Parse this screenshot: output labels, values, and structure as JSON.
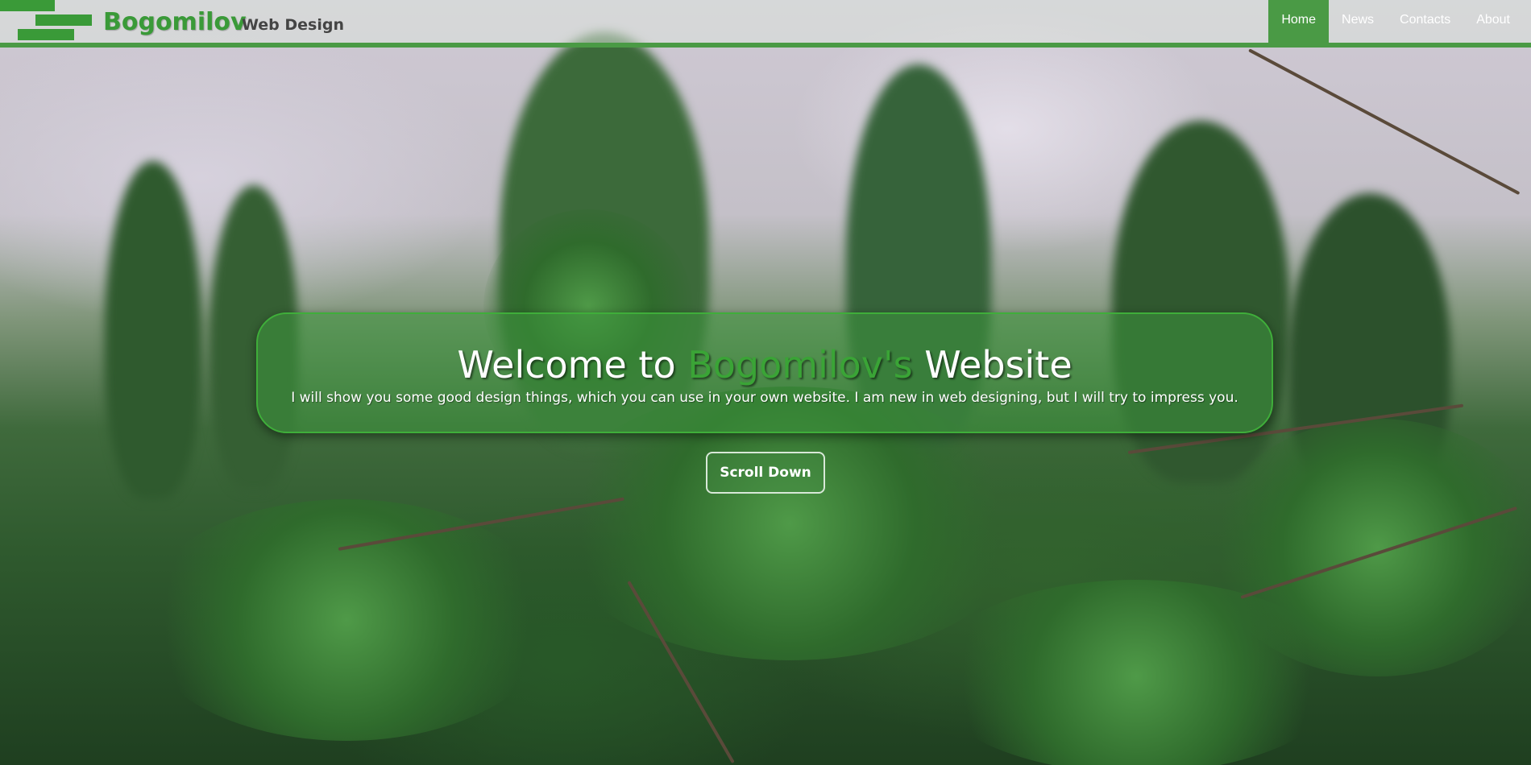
{
  "header": {
    "brand_name": "Bogomilov",
    "brand_tagline": "Web Design"
  },
  "nav": {
    "items": [
      {
        "label": "Home",
        "active": true
      },
      {
        "label": "News",
        "active": false
      },
      {
        "label": "Contacts",
        "active": false
      },
      {
        "label": "About",
        "active": false
      }
    ]
  },
  "hero": {
    "title_before": "Welcome to ",
    "title_accent": "Bogomilov's",
    "title_after": " Website",
    "text": "I will show you some good design things, which you can use in your own website. I am new in web designing, but I will try to impress you.",
    "button_label": "Scroll Down"
  },
  "colors": {
    "accent": "#3a9a38",
    "nav_active": "#4a9a45",
    "text_light": "#ffffff"
  },
  "icons": {
    "logo": "stacked-bars-logo"
  }
}
